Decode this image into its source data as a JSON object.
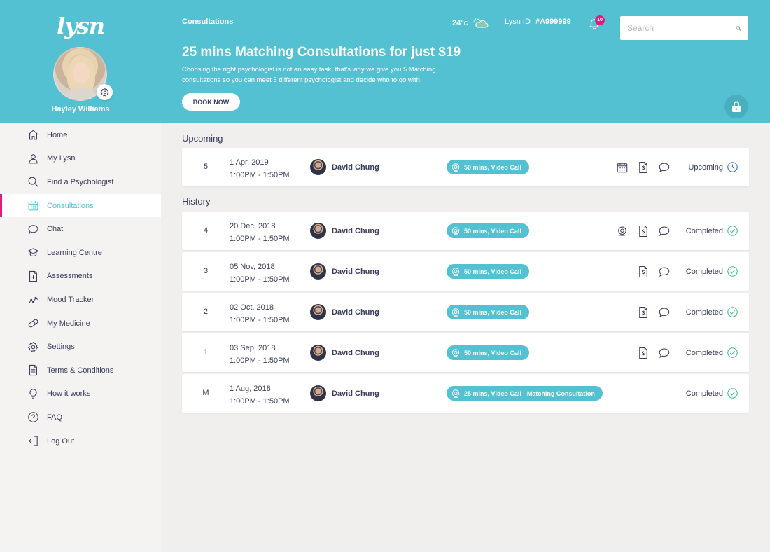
{
  "app": {
    "logo": "lysn"
  },
  "profile": {
    "name": "Hayley Williams"
  },
  "nav": [
    {
      "label": "Home",
      "icon": "home-icon"
    },
    {
      "label": "My Lysn",
      "icon": "user-icon"
    },
    {
      "label": "Find a Psychologist",
      "icon": "search-icon"
    },
    {
      "label": "Consultations",
      "icon": "calendar-icon",
      "active": true
    },
    {
      "label": "Chat",
      "icon": "chat-icon"
    },
    {
      "label": "Learning Centre",
      "icon": "graduation-cap-icon"
    },
    {
      "label": "Assessments",
      "icon": "document-plus-icon"
    },
    {
      "label": "Mood Tracker",
      "icon": "line-graph-icon"
    },
    {
      "label": "My Medicine",
      "icon": "pill-icon"
    },
    {
      "label": "Settings",
      "icon": "gear-icon"
    },
    {
      "label": "Terms & Conditions",
      "icon": "document-icon"
    },
    {
      "label": "How it works",
      "icon": "lightbulb-icon"
    },
    {
      "label": "FAQ",
      "icon": "question-icon"
    },
    {
      "label": "Log Out",
      "icon": "logout-icon"
    }
  ],
  "header": {
    "breadcrumb": "Consultations",
    "temperature": "24°c",
    "lysn_id_label": "Lysn ID",
    "lysn_id": "#A999999",
    "notifications": "10",
    "search_placeholder": "Search",
    "promo_title": "25 mins Matching Consultations for just $19",
    "promo_text": "Choosing the right psychologist is not an easy task, that's why we give you 5 Matching consultations so you can meet 5 different psychologist and decide who to go with.",
    "book_label": "BOOK NOW"
  },
  "sections": {
    "upcoming": "Upcoming",
    "history": "History"
  },
  "upcoming": [
    {
      "num": "5",
      "date": "1 Apr, 2019",
      "time": "1:00PM - 1:50PM",
      "psychologist": "David Chung",
      "type": "50 mins, Video Call",
      "actions": [
        "calendar",
        "invoice",
        "chat"
      ],
      "status": "Upcoming"
    }
  ],
  "history": [
    {
      "num": "4",
      "date": "20 Dec, 2018",
      "time": "1:00PM - 1:50PM",
      "psychologist": "David Chung",
      "type": "50 mins, Video Call",
      "actions": [
        "webcam",
        "invoice",
        "chat"
      ],
      "status": "Completed"
    },
    {
      "num": "3",
      "date": "05 Nov, 2018",
      "time": "1:00PM - 1:50PM",
      "psychologist": "David Chung",
      "type": "50 mins, Video Call",
      "actions": [
        "invoice",
        "chat"
      ],
      "status": "Completed"
    },
    {
      "num": "2",
      "date": "02 Oct, 2018",
      "time": "1:00PM - 1:50PM",
      "psychologist": "David Chung",
      "type": "50 mins, Video Call",
      "actions": [
        "invoice",
        "chat"
      ],
      "status": "Completed"
    },
    {
      "num": "1",
      "date": "03 Sep, 2018",
      "time": "1:00PM - 1:50PM",
      "psychologist": "David Chung",
      "type": "50 mins, Video Call",
      "actions": [
        "invoice",
        "chat"
      ],
      "status": "Completed"
    },
    {
      "num": "M",
      "date": "1 Aug, 2018",
      "time": "1:00PM - 1:50PM",
      "psychologist": "David Chung",
      "type": "25 mins, Video Call - Matching Consultation",
      "actions": [],
      "status": "Completed"
    }
  ],
  "colors": {
    "brand": "#54c1d2",
    "accent": "#e6197d",
    "text": "#3b3d5c",
    "success": "#3fbf8a"
  }
}
